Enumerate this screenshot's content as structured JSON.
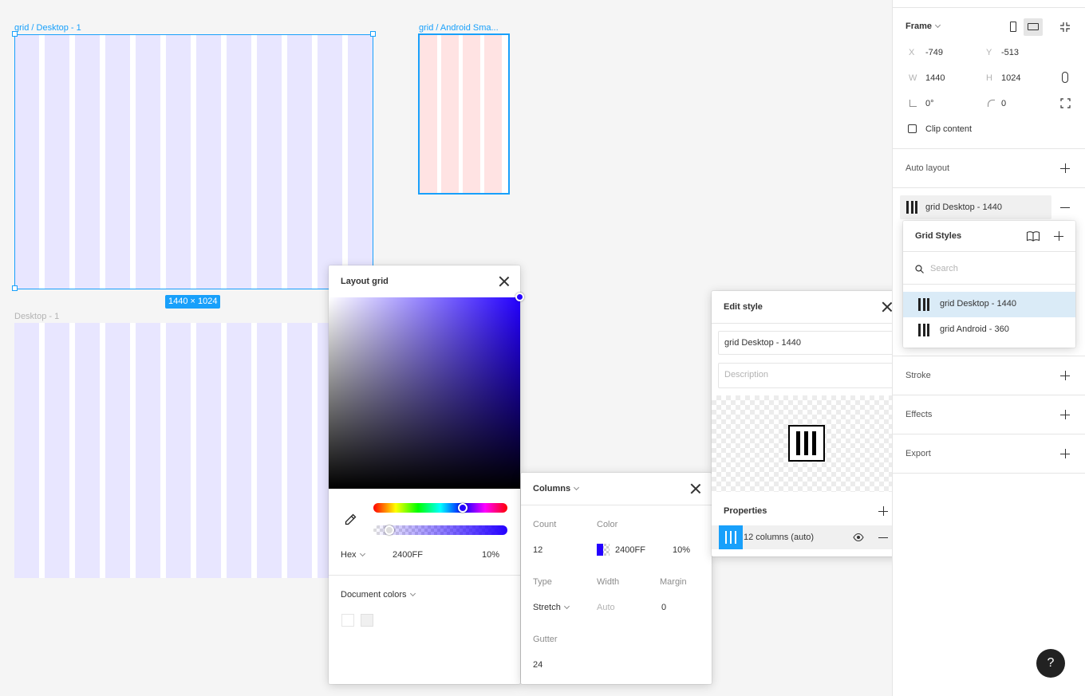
{
  "canvas": {
    "frame1": {
      "label": "grid / Desktop - 1",
      "size_badge": "1440 × 1024",
      "column_color": "#e8e6ff"
    },
    "frame2": {
      "label": "grid / Android Sma...",
      "column_color": "#ffe3e3"
    },
    "frame3": {
      "label": "Desktop - 1",
      "column_color": "#e8e6ff"
    }
  },
  "layout_grid_panel": {
    "title": "Layout grid",
    "hex_mode": "Hex",
    "hex_value": "2400FF",
    "opacity": "10%",
    "hue_color": "#2400ff",
    "document_colors_label": "Document colors"
  },
  "columns_panel": {
    "title": "Columns",
    "count_label": "Count",
    "count_value": "12",
    "color_label": "Color",
    "color_hex": "2400FF",
    "color_opacity": "10%",
    "type_label": "Type",
    "type_value": "Stretch",
    "width_label": "Width",
    "width_value": "Auto",
    "margin_label": "Margin",
    "margin_value": "0",
    "gutter_label": "Gutter",
    "gutter_value": "24"
  },
  "edit_style_panel": {
    "title": "Edit style",
    "name_value": "grid Desktop - 1440",
    "description_placeholder": "Description",
    "properties_label": "Properties",
    "property_item": "12 columns (auto)"
  },
  "right_panel": {
    "frame_label": "Frame",
    "x_label": "X",
    "x_value": "-749",
    "y_label": "Y",
    "y_value": "-513",
    "w_label": "W",
    "w_value": "1440",
    "h_label": "H",
    "h_value": "1024",
    "rotation_value": "0°",
    "radius_value": "0",
    "clip_content_label": "Clip content",
    "auto_layout_label": "Auto layout",
    "grid_style_name": "grid Desktop - 1440",
    "stroke_label": "Stroke",
    "effects_label": "Effects",
    "export_label": "Export"
  },
  "grid_styles_popup": {
    "title": "Grid Styles",
    "search_placeholder": "Search",
    "items": [
      {
        "label": "grid Desktop - 1440"
      },
      {
        "label": "grid Android - 360"
      }
    ]
  },
  "help": {
    "label": "?"
  }
}
